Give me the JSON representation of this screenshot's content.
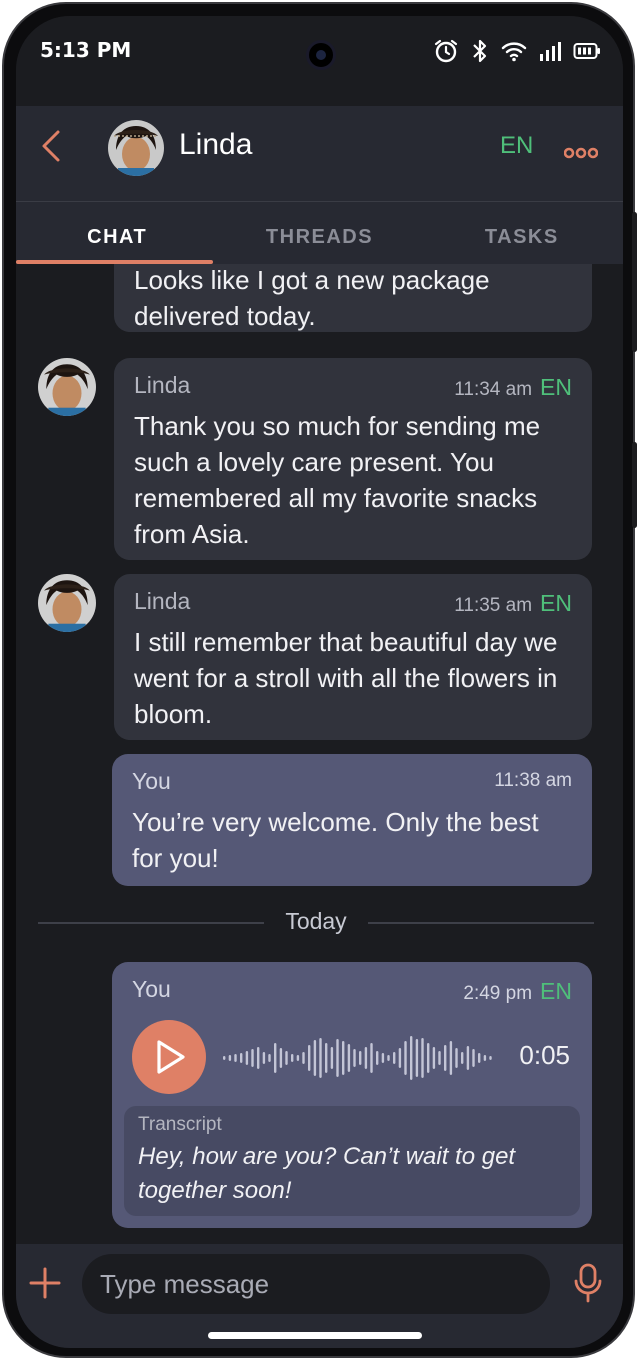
{
  "status_bar": {
    "time": "5:13 PM"
  },
  "header": {
    "contact_name": "Linda",
    "language": "EN",
    "back_icon": "chevron-left-icon",
    "more_icon": "more-dots-icon",
    "accent_color": "#df8066"
  },
  "tabs": [
    {
      "label": "CHAT",
      "active": true
    },
    {
      "label": "THREADS",
      "active": false
    },
    {
      "label": "TASKS",
      "active": false
    }
  ],
  "messages": [
    {
      "sender": "",
      "time": "",
      "lang": "",
      "text": "Looks like I got a new package delivered today.",
      "direction": "in"
    },
    {
      "sender": "Linda",
      "time": "11:34 am",
      "lang": "EN",
      "text": "Thank you so much for sending me such a lovely care present. You remembered all my favorite snacks from Asia.",
      "direction": "in"
    },
    {
      "sender": "Linda",
      "time": "11:35 am",
      "lang": "EN",
      "text": "I still remember that beautiful day we went for a stroll with all the flowers in bloom.",
      "direction": "in"
    },
    {
      "sender": "You",
      "time": "11:38 am",
      "lang": "",
      "text": "You’re very welcome. Only the best for you!",
      "direction": "out"
    }
  ],
  "date_divider": "Today",
  "voice_message": {
    "sender": "You",
    "time": "2:49 pm",
    "lang": "EN",
    "duration": "0:05",
    "transcript_label": "Transcript",
    "transcript": "Hey, how are you? Can’t wait to get together soon!"
  },
  "composer": {
    "placeholder": "Type message"
  },
  "colors": {
    "background": "#1b1c20",
    "header": "#272932",
    "incoming_bubble": "#31333c",
    "outgoing_bubble": "#555876",
    "language_green": "#4fbf7a",
    "accent": "#df8066"
  }
}
